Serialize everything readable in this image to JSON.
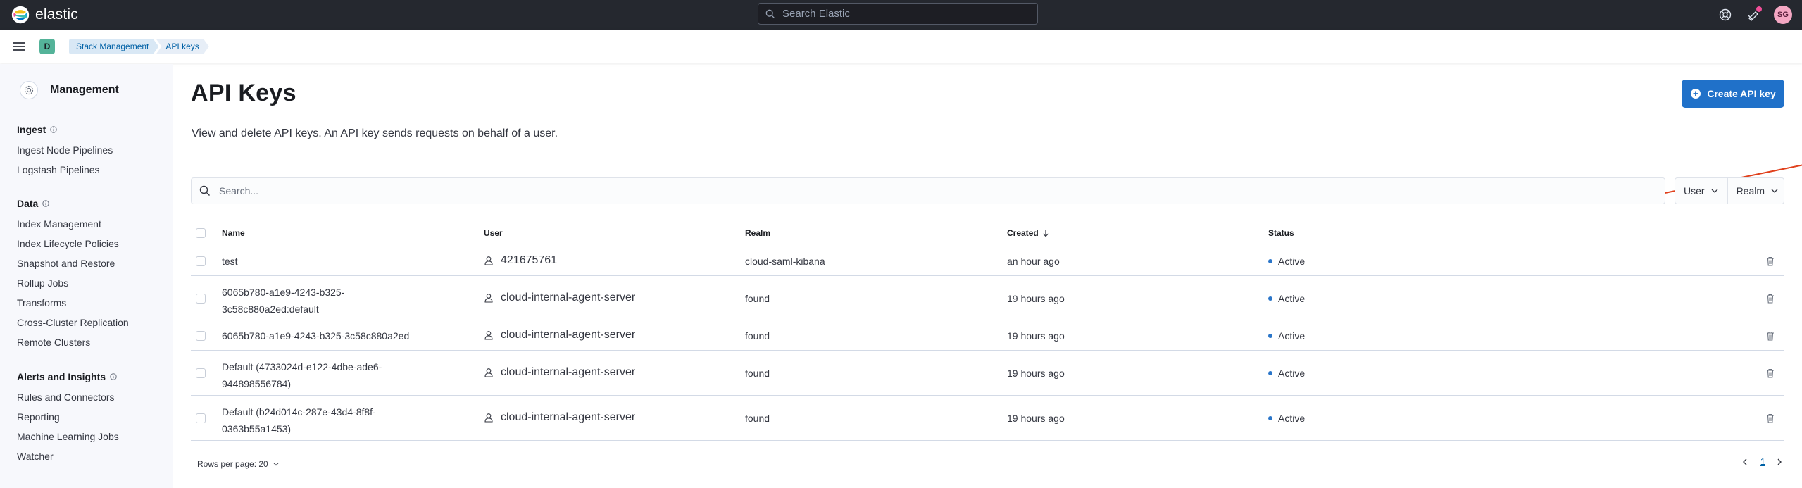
{
  "header": {
    "brand": "elastic",
    "search_placeholder": "Search Elastic",
    "avatar_initials": "SG"
  },
  "breadcrumb": {
    "space_initial": "D",
    "items": [
      "Stack Management",
      "API keys"
    ]
  },
  "sidebar": {
    "title": "Management",
    "groups": [
      {
        "title": "Ingest",
        "items": [
          "Ingest Node Pipelines",
          "Logstash Pipelines"
        ]
      },
      {
        "title": "Data",
        "items": [
          "Index Management",
          "Index Lifecycle Policies",
          "Snapshot and Restore",
          "Rollup Jobs",
          "Transforms",
          "Cross-Cluster Replication",
          "Remote Clusters"
        ]
      },
      {
        "title": "Alerts and Insights",
        "items": [
          "Rules and Connectors",
          "Reporting",
          "Machine Learning Jobs",
          "Watcher"
        ]
      }
    ]
  },
  "main": {
    "title": "API Keys",
    "description": "View and delete API keys. An API key sends requests on behalf of a user.",
    "create_button": "Create API key",
    "search_placeholder": "Search...",
    "filters": [
      "User",
      "Realm"
    ],
    "columns": [
      "Name",
      "User",
      "Realm",
      "Created",
      "Status"
    ],
    "rows": [
      {
        "name": [
          "test"
        ],
        "user": "421675761",
        "realm": "cloud-saml-kibana",
        "created": "an hour ago",
        "status": "Active"
      },
      {
        "name": [
          "6065b780-a1e9-4243-b325-",
          "3c58c880a2ed:default"
        ],
        "user": "cloud-internal-agent-server",
        "realm": "found",
        "created": "19 hours ago",
        "status": "Active"
      },
      {
        "name": [
          "6065b780-a1e9-4243-b325-3c58c880a2ed"
        ],
        "user": "cloud-internal-agent-server",
        "realm": "found",
        "created": "19 hours ago",
        "status": "Active"
      },
      {
        "name": [
          "Default (4733024d-e122-4dbe-ade6-",
          "944898556784)"
        ],
        "user": "cloud-internal-agent-server",
        "realm": "found",
        "created": "19 hours ago",
        "status": "Active"
      },
      {
        "name": [
          "Default (b24d014c-287e-43d4-8f8f-",
          "0363b55a1453)"
        ],
        "user": "cloud-internal-agent-server",
        "realm": "found",
        "created": "19 hours ago",
        "status": "Active"
      }
    ],
    "rows_per_page": "Rows per page: 20",
    "current_page": "1"
  },
  "colors": {
    "header_bg": "#25282f",
    "primary": "#2071c9",
    "annotation_arrow": "#e0401c",
    "status_dot": "#2b76c9"
  },
  "icons": [
    "elastic-logo-icon",
    "search-icon",
    "help-icon",
    "newsfeed-icon",
    "menu-icon",
    "gear-icon",
    "info-icon",
    "plus-circle-icon",
    "chevron-down-icon",
    "sort-arrow-down-icon",
    "user-icon",
    "trash-icon",
    "chevron-left-icon",
    "chevron-right-icon"
  ]
}
